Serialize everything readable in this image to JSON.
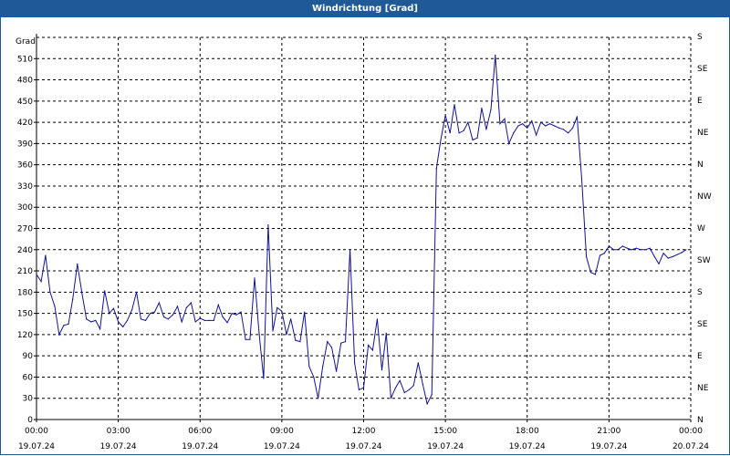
{
  "title": "Windrichtung [Grad]",
  "colors": {
    "titlebar": "#1f5a96",
    "line": "#1010a0",
    "grid": "#000000"
  },
  "chart_data": {
    "type": "line",
    "title": "Windrichtung [Grad]",
    "ylabel": "Grad",
    "xlabel": "",
    "ylim": [
      0,
      540
    ],
    "grid": true,
    "y_ticks": [
      0,
      30,
      60,
      90,
      120,
      150,
      180,
      210,
      240,
      270,
      300,
      330,
      360,
      390,
      420,
      450,
      480,
      510
    ],
    "right_axis_labels": [
      "N",
      "NE",
      "E",
      "SE",
      "S",
      "SW",
      "W",
      "NW",
      "N",
      "NE",
      "E",
      "SE",
      "S"
    ],
    "x_ticks": [
      {
        "time": "00:00",
        "date": "19.07.24"
      },
      {
        "time": "03:00",
        "date": "19.07.24"
      },
      {
        "time": "06:00",
        "date": "19.07.24"
      },
      {
        "time": "09:00",
        "date": "19.07.24"
      },
      {
        "time": "12:00",
        "date": "19.07.24"
      },
      {
        "time": "15:00",
        "date": "19.07.24"
      },
      {
        "time": "18:00",
        "date": "19.07.24"
      },
      {
        "time": "21:00",
        "date": "19.07.24"
      },
      {
        "time": "00:00",
        "date": "20.07.24"
      }
    ],
    "x_unit": "hours since 19.07.24 00:00",
    "series": [
      {
        "values": [
          [
            0.0,
            205
          ],
          [
            0.17,
            195
          ],
          [
            0.33,
            232
          ],
          [
            0.5,
            180
          ],
          [
            0.67,
            160
          ],
          [
            0.83,
            120
          ],
          [
            1.0,
            133
          ],
          [
            1.17,
            135
          ],
          [
            1.33,
            170
          ],
          [
            1.5,
            220
          ],
          [
            1.67,
            178
          ],
          [
            1.83,
            142
          ],
          [
            2.0,
            138
          ],
          [
            2.17,
            140
          ],
          [
            2.33,
            128
          ],
          [
            2.5,
            182
          ],
          [
            2.67,
            150
          ],
          [
            2.83,
            157
          ],
          [
            3.0,
            138
          ],
          [
            3.17,
            131
          ],
          [
            3.33,
            140
          ],
          [
            3.5,
            155
          ],
          [
            3.67,
            180
          ],
          [
            3.83,
            142
          ],
          [
            4.0,
            140
          ],
          [
            4.17,
            150
          ],
          [
            4.33,
            152
          ],
          [
            4.5,
            165
          ],
          [
            4.67,
            145
          ],
          [
            4.83,
            142
          ],
          [
            5.0,
            148
          ],
          [
            5.17,
            160
          ],
          [
            5.33,
            138
          ],
          [
            5.5,
            158
          ],
          [
            5.67,
            165
          ],
          [
            5.83,
            138
          ],
          [
            6.0,
            143
          ],
          [
            6.17,
            140
          ],
          [
            6.33,
            140
          ],
          [
            6.5,
            140
          ],
          [
            6.67,
            162
          ],
          [
            6.83,
            145
          ],
          [
            7.0,
            137
          ],
          [
            7.17,
            150
          ],
          [
            7.33,
            148
          ],
          [
            7.5,
            152
          ],
          [
            7.67,
            113
          ],
          [
            7.83,
            113
          ],
          [
            8.0,
            200
          ],
          [
            8.17,
            120
          ],
          [
            8.33,
            58
          ],
          [
            8.5,
            275
          ],
          [
            8.67,
            125
          ],
          [
            8.83,
            158
          ],
          [
            9.0,
            153
          ],
          [
            9.17,
            120
          ],
          [
            9.33,
            142
          ],
          [
            9.5,
            112
          ],
          [
            9.67,
            110
          ],
          [
            9.83,
            152
          ],
          [
            10.0,
            75
          ],
          [
            10.17,
            60
          ],
          [
            10.33,
            30
          ],
          [
            10.5,
            75
          ],
          [
            10.67,
            110
          ],
          [
            10.83,
            102
          ],
          [
            11.0,
            68
          ],
          [
            11.17,
            108
          ],
          [
            11.33,
            110
          ],
          [
            11.5,
            240
          ],
          [
            11.67,
            80
          ],
          [
            11.83,
            42
          ],
          [
            12.0,
            45
          ],
          [
            12.17,
            105
          ],
          [
            12.33,
            98
          ],
          [
            12.5,
            142
          ],
          [
            12.67,
            70
          ],
          [
            12.83,
            122
          ],
          [
            13.0,
            30
          ],
          [
            13.17,
            45
          ],
          [
            13.33,
            55
          ],
          [
            13.5,
            38
          ],
          [
            13.67,
            42
          ],
          [
            13.83,
            48
          ],
          [
            14.0,
            80
          ],
          [
            14.17,
            50
          ],
          [
            14.33,
            22
          ],
          [
            14.5,
            35
          ],
          [
            14.67,
            355
          ],
          [
            14.83,
            395
          ],
          [
            15.0,
            430
          ],
          [
            15.17,
            405
          ],
          [
            15.33,
            445
          ],
          [
            15.5,
            405
          ],
          [
            15.67,
            408
          ],
          [
            15.83,
            420
          ],
          [
            16.0,
            395
          ],
          [
            16.17,
            398
          ],
          [
            16.33,
            440
          ],
          [
            16.5,
            410
          ],
          [
            16.67,
            438
          ],
          [
            16.83,
            515
          ],
          [
            17.0,
            418
          ],
          [
            17.17,
            425
          ],
          [
            17.33,
            390
          ],
          [
            17.5,
            405
          ],
          [
            17.67,
            415
          ],
          [
            17.83,
            418
          ],
          [
            18.0,
            412
          ],
          [
            18.17,
            422
          ],
          [
            18.33,
            402
          ],
          [
            18.5,
            420
          ],
          [
            18.67,
            415
          ],
          [
            18.83,
            418
          ],
          [
            19.0,
            415
          ],
          [
            19.17,
            412
          ],
          [
            19.33,
            410
          ],
          [
            19.5,
            405
          ],
          [
            19.67,
            412
          ],
          [
            19.83,
            428
          ],
          [
            20.0,
            340
          ],
          [
            20.17,
            230
          ],
          [
            20.33,
            208
          ],
          [
            20.5,
            205
          ],
          [
            20.67,
            232
          ],
          [
            20.83,
            235
          ],
          [
            21.0,
            245
          ],
          [
            21.17,
            240
          ],
          [
            21.33,
            240
          ],
          [
            21.5,
            245
          ],
          [
            21.67,
            242
          ],
          [
            21.83,
            240
          ],
          [
            22.0,
            242
          ],
          [
            22.17,
            240
          ],
          [
            22.33,
            240
          ],
          [
            22.5,
            242
          ],
          [
            22.67,
            230
          ],
          [
            22.83,
            220
          ],
          [
            23.0,
            235
          ],
          [
            23.17,
            228
          ],
          [
            23.33,
            230
          ],
          [
            23.5,
            233
          ],
          [
            23.67,
            236
          ],
          [
            23.83,
            240
          ]
        ]
      }
    ]
  }
}
